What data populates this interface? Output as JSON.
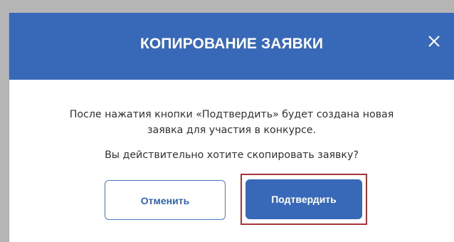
{
  "dialog": {
    "title": "КОПИРОВАНИЕ ЗАЯВКИ",
    "close_icon": "close-icon",
    "message_line_1": "После нажатия кнопки «Подтвердить» будет создана новая",
    "message_line_2": "заявка для участия в конкурсе.",
    "question": "Вы действительно хотите скопировать заявку?",
    "cancel_label": "Отменить",
    "confirm_label": "Подтвердить"
  },
  "colors": {
    "header_bg": "#3869b8",
    "confirm_bg": "#3869b8",
    "cancel_border": "#4b79c2",
    "highlight_border": "#a4353a",
    "backdrop": "#b5b5b5"
  }
}
